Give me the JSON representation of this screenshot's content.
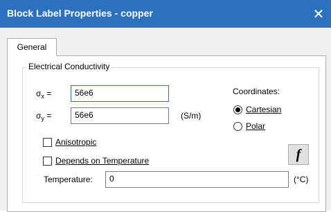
{
  "window": {
    "title": "Block Label Properties - copper",
    "close_glyph": "✕"
  },
  "tabs": [
    {
      "label": "General",
      "selected": true
    }
  ],
  "group": {
    "label": "Electrical Conductivity"
  },
  "sigma_x": {
    "symbol": "σ",
    "subscript": "x",
    "equals": "=",
    "value": "56e6"
  },
  "sigma_y": {
    "symbol": "σ",
    "subscript": "y",
    "equals": "=",
    "value": "56e6"
  },
  "units": "(S/m)",
  "coordinates": {
    "label": "Coordinates:",
    "options": [
      {
        "label": "Cartesian",
        "selected": true
      },
      {
        "label": "Polar",
        "selected": false
      }
    ]
  },
  "checkboxes": {
    "anisotropic": {
      "label": "Anisotropic",
      "checked": false
    },
    "depends_on_temperature": {
      "label": "Depends on Temperature",
      "checked": false
    }
  },
  "function_button": {
    "label": "f"
  },
  "temperature": {
    "label": "Temperature:",
    "value": "0",
    "unit": "(°C)"
  },
  "colors": {
    "titlebar": "#2b71c0",
    "client_bg": "#f0f0f0",
    "panel_bg": "#ffffff"
  }
}
